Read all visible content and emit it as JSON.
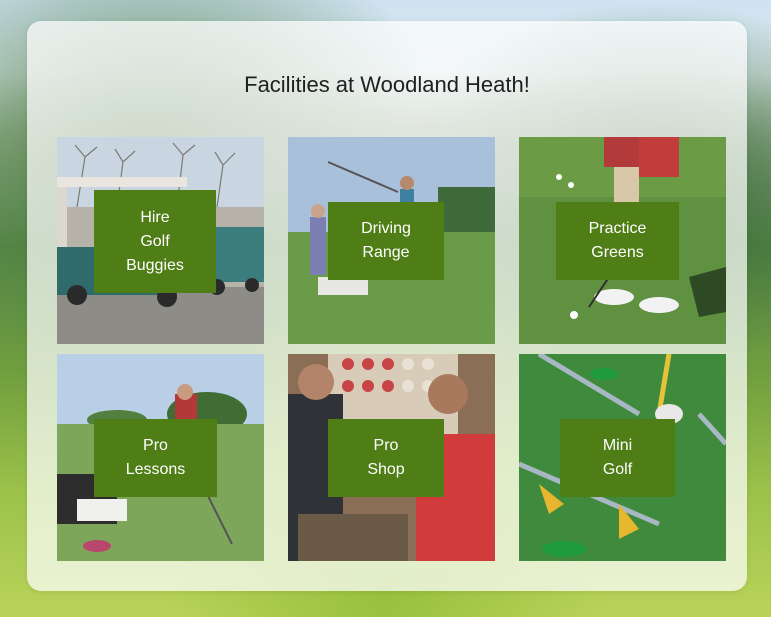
{
  "page": {
    "title": "Facilities at Woodland Heath!"
  },
  "colors": {
    "label_background": "#4f7d16",
    "label_text": "#ffffff",
    "title_text": "#1f1f1f"
  },
  "facilities": [
    {
      "name": "Hire Golf Buggies",
      "lines": [
        "Hire",
        "Golf",
        "Buggies"
      ],
      "image": "golf-carts-photo"
    },
    {
      "name": "Driving Range",
      "lines": [
        "Driving",
        "Range"
      ],
      "image": "driving-range-photo"
    },
    {
      "name": "Practice Greens",
      "lines": [
        "Practice",
        "Greens"
      ],
      "image": "putting-green-photo"
    },
    {
      "name": "Pro Lessons",
      "lines": [
        "Pro",
        "Lessons"
      ],
      "image": "golf-lesson-photo"
    },
    {
      "name": "Pro Shop",
      "lines": [
        "Pro",
        "Shop"
      ],
      "image": "pro-shop-photo"
    },
    {
      "name": "Mini Golf",
      "lines": [
        "Mini",
        "Golf"
      ],
      "image": "mini-golf-photo"
    }
  ]
}
